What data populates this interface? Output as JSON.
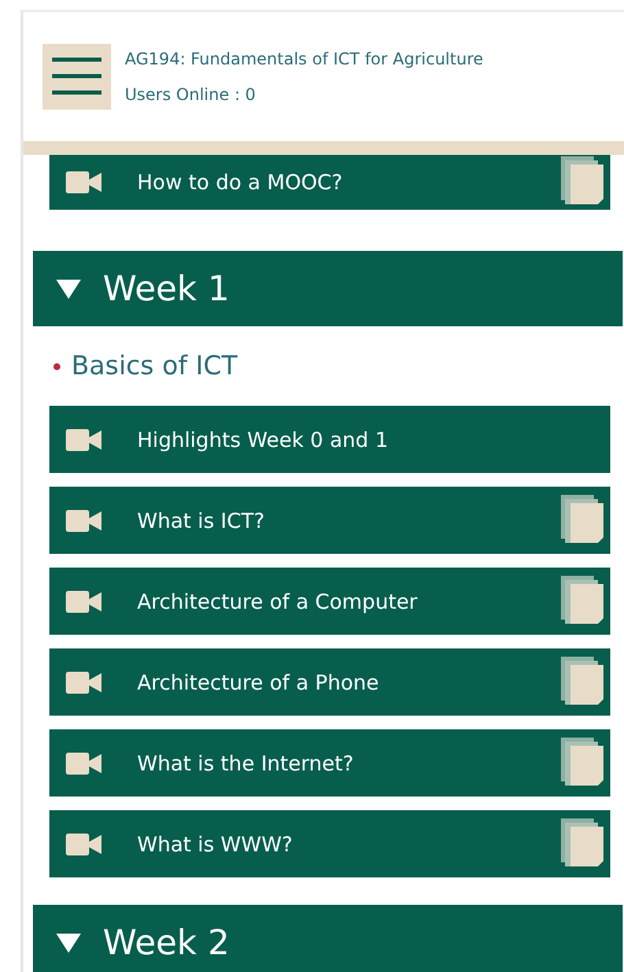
{
  "header": {
    "course_title": "AG194: Fundamentals of ICT for Agriculture",
    "users_online": "Users Online : 0"
  },
  "top_items": [
    {
      "title": "How to do a MOOC?",
      "has_documents": true
    }
  ],
  "weeks": [
    {
      "title": "Week 1",
      "expanded": true,
      "sections": [
        {
          "title": "Basics of ICT",
          "items": [
            {
              "title": "Highlights Week 0 and 1",
              "has_documents": false
            },
            {
              "title": "What is ICT?",
              "has_documents": true
            },
            {
              "title": "Architecture of a Computer",
              "has_documents": true
            },
            {
              "title": "Architecture of a Phone",
              "has_documents": true
            },
            {
              "title": "What is the Internet?",
              "has_documents": true
            },
            {
              "title": "What is WWW?",
              "has_documents": true
            }
          ]
        }
      ]
    },
    {
      "title": "Week 2",
      "expanded": true
    }
  ]
}
